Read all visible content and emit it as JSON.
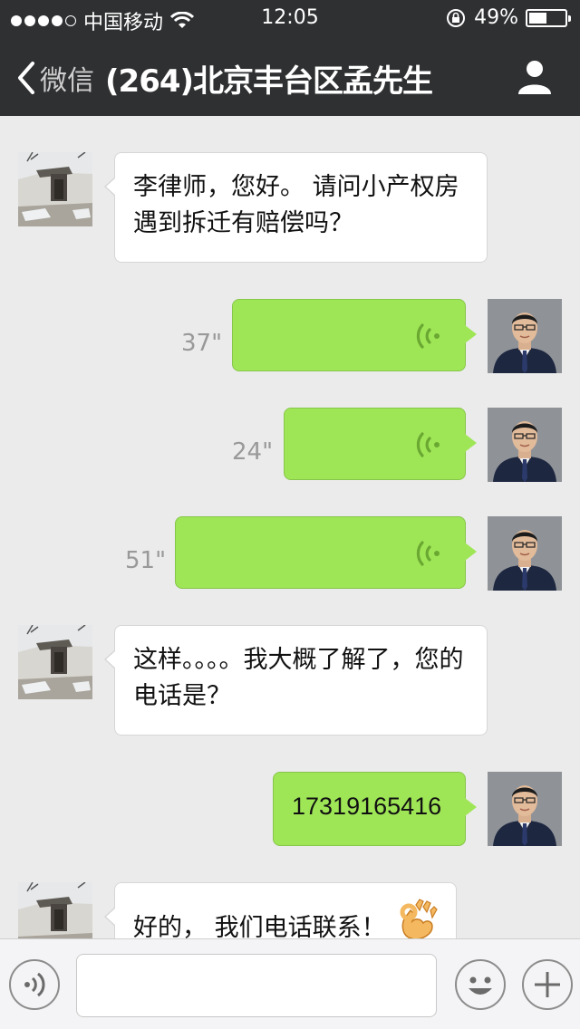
{
  "status_bar": {
    "carrier": "中国移动",
    "time": "12:05",
    "battery_text": "49%",
    "battery_level": 0.49
  },
  "nav": {
    "back_label": "微信",
    "title": "(264)北京丰台区孟先生",
    "profile_icon": "person-icon"
  },
  "messages": [
    {
      "side": "left",
      "type": "text",
      "text": "李律师，您好。 请问小产权房遇到拆迁有赔偿吗？"
    },
    {
      "side": "right",
      "type": "voice",
      "duration": "37\""
    },
    {
      "side": "right",
      "type": "voice",
      "duration": "24\""
    },
    {
      "side": "right",
      "type": "voice",
      "duration": "51\""
    },
    {
      "side": "left",
      "type": "text",
      "text": "这样。。。。我大概了解了，您的电话是？"
    },
    {
      "side": "right",
      "type": "text",
      "text": "17319165416"
    },
    {
      "side": "left",
      "type": "text",
      "text": "好的， 我们电话联系！",
      "emoji": "ok-hand-emoji"
    }
  ],
  "input_bar": {
    "voice_button_icon": "voice-input-icon",
    "emoji_button_icon": "smiley-icon",
    "plus_button_icon": "plus-icon",
    "text_value": ""
  },
  "colors": {
    "bar_background": "#2f3032",
    "chat_background": "#ebebeb",
    "sent_bubble": "#9fe657",
    "received_bubble": "#ffffff",
    "voice_icon": "#6aa832"
  }
}
